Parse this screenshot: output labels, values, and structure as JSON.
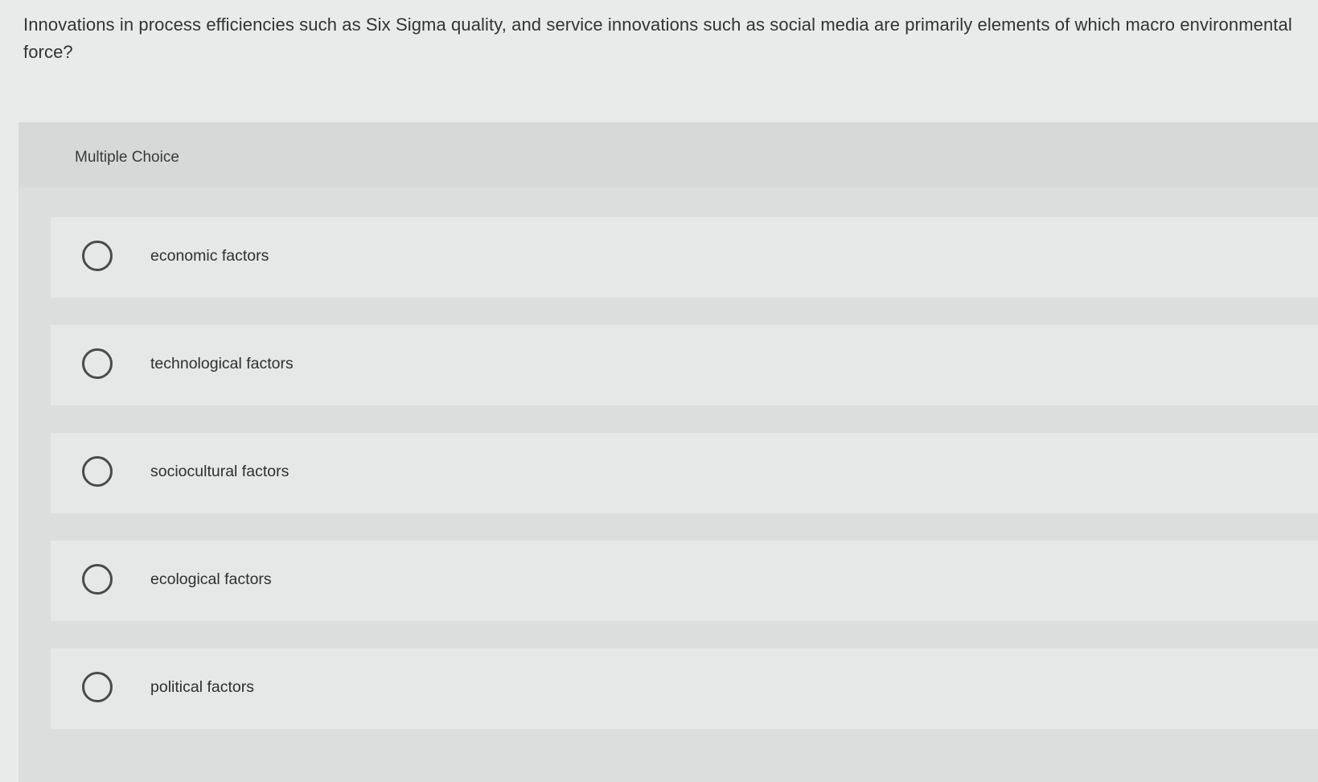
{
  "question": {
    "text": "Innovations in process efficiencies such as Six Sigma quality, and service innovations such as social media are primarily elements of which macro environmental force?"
  },
  "quiz": {
    "type_label": "Multiple Choice",
    "options": [
      {
        "label": "economic factors",
        "selected": false
      },
      {
        "label": "technological factors",
        "selected": false
      },
      {
        "label": "sociocultural factors",
        "selected": false
      },
      {
        "label": "ecological factors",
        "selected": false
      },
      {
        "label": "political factors",
        "selected": false
      }
    ]
  },
  "colors": {
    "page_background": "#e9eaea",
    "panel_background": "#dcdddd",
    "option_background": "#e6e7e7",
    "radio_border": "#4a4a4a",
    "text": "#2f2f2f"
  }
}
